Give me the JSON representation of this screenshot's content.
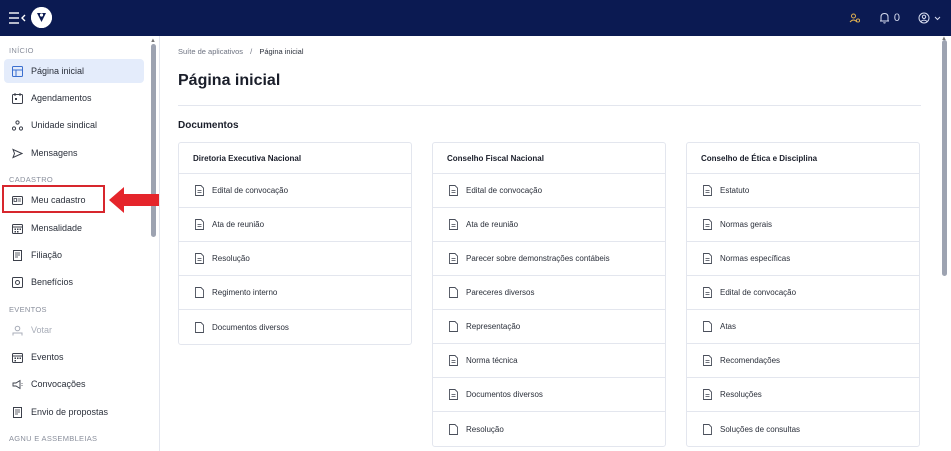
{
  "topbar": {
    "notifications_count": "0"
  },
  "sidebar": {
    "sections": {
      "inicio": "INÍCIO",
      "cadastro": "CADASTRO",
      "eventos": "EVENTOS",
      "agnu": "AGNU E ASSEMBLEIAS"
    },
    "items": [
      {
        "label": "Página inicial",
        "icon": "home-icon"
      },
      {
        "label": "Agendamentos",
        "icon": "calendar-icon"
      },
      {
        "label": "Unidade sindical",
        "icon": "network-icon"
      },
      {
        "label": "Mensagens",
        "icon": "send-icon"
      },
      {
        "label": "Meu cadastro",
        "icon": "id-card-icon"
      },
      {
        "label": "Mensalidade",
        "icon": "calendar-grid-icon"
      },
      {
        "label": "Filiação",
        "icon": "document-icon"
      },
      {
        "label": "Benefícios",
        "icon": "benefit-icon"
      },
      {
        "label": "Votar",
        "icon": "vote-icon"
      },
      {
        "label": "Eventos",
        "icon": "calendar-grid-icon"
      },
      {
        "label": "Convocações",
        "icon": "megaphone-icon"
      },
      {
        "label": "Envio de propostas",
        "icon": "document-icon"
      }
    ]
  },
  "main": {
    "breadcrumb": {
      "parent": "Suíte de aplicativos",
      "separator": "/",
      "current": "Página inicial"
    },
    "title": "Página inicial",
    "section_title": "Documentos",
    "cards": [
      {
        "title": "Diretoria Executiva Nacional",
        "items": [
          "Edital de convocação",
          "Ata de reunião",
          "Resolução",
          "Regimento interno",
          "Documentos diversos"
        ]
      },
      {
        "title": "Conselho Fiscal Nacional",
        "items": [
          "Edital de convocação",
          "Ata de reunião",
          "Parecer sobre demonstrações contábeis",
          "Pareceres diversos",
          "Representação",
          "Norma técnica",
          "Documentos diversos",
          "Resolução"
        ]
      },
      {
        "title": "Conselho de Ética e Disciplina",
        "items": [
          "Estatuto",
          "Normas gerais",
          "Normas específicas",
          "Edital de convocação",
          "Atas",
          "Recomendações",
          "Resoluções",
          "Soluções de consultas"
        ]
      }
    ]
  },
  "colors": {
    "topbar": "#0b1a52",
    "active_nav": "#e4ecfb",
    "highlight": "#d7262d"
  }
}
